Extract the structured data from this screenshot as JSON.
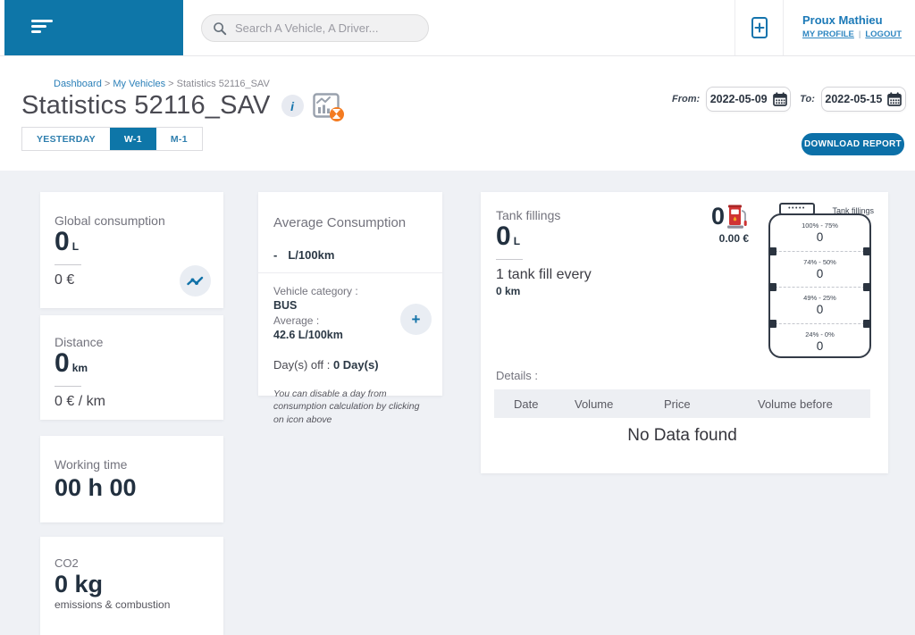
{
  "header": {
    "search_placeholder": "Search A Vehicle, A Driver...",
    "user_name": "Proux Mathieu",
    "my_profile_label": "MY PROFILE",
    "logout_label": "LOGOUT"
  },
  "breadcrumb": {
    "items": [
      "Dashboard",
      "My Vehicles",
      "Statistics 52116_SAV"
    ]
  },
  "page": {
    "title": "Statistics 52116_SAV"
  },
  "tabs": [
    {
      "label": "YESTERDAY",
      "active": false
    },
    {
      "label": "W-1",
      "active": true
    },
    {
      "label": "M-1",
      "active": false
    }
  ],
  "date_range": {
    "from_label": "From:",
    "from_value": "2022-05-09",
    "to_label": "To:",
    "to_value": "2022-05-15"
  },
  "download_button_label": "DOWNLOAD REPORT",
  "cards": {
    "global_consumption": {
      "title": "Global consumption",
      "value": "0",
      "unit": "L",
      "secondary": "0 €"
    },
    "distance": {
      "title": "Distance",
      "value": "0",
      "unit": "km",
      "secondary": "0 € / km"
    },
    "working_time": {
      "title": "Working time",
      "value": "00 h 00"
    },
    "co2": {
      "title": "CO2",
      "value": "0 kg",
      "subtitle": "emissions & combustion"
    },
    "average_consumption": {
      "title": "Average Consumption",
      "value": "-",
      "unit": "L/100km",
      "vehicle_category_label": "Vehicle category :",
      "vehicle_category": "BUS",
      "average_label": "Average :",
      "average_value": "42.6 L/100km",
      "days_off_label": "Day(s) off : ",
      "days_off_value": "0 Day(s)",
      "note": "You can disable a day from consumption calculation by clicking on icon above"
    },
    "tank_fillings": {
      "title": "Tank fillings",
      "value": "0",
      "unit": "L",
      "fill_frequency": "1 tank fill every",
      "fill_distance": "0 km",
      "count": "0",
      "total_price": "0.00 €",
      "diagram_label": "Tank fillings",
      "segments": [
        {
          "range": "100% - 75%",
          "count": "0"
        },
        {
          "range": "74% - 50%",
          "count": "0"
        },
        {
          "range": "49% - 25%",
          "count": "0"
        },
        {
          "range": "24% - 0%",
          "count": "0"
        }
      ],
      "details_label": "Details :",
      "table_headers": [
        "Date",
        "Volume",
        "Price",
        "Volume before"
      ],
      "no_data": "No Data found"
    }
  },
  "colors": {
    "brand_blue": "#0e76a8",
    "link_blue": "#2e86c1",
    "accent_orange": "#f47b20",
    "pump_red": "#d03434",
    "page_background": "#eff1f5"
  }
}
